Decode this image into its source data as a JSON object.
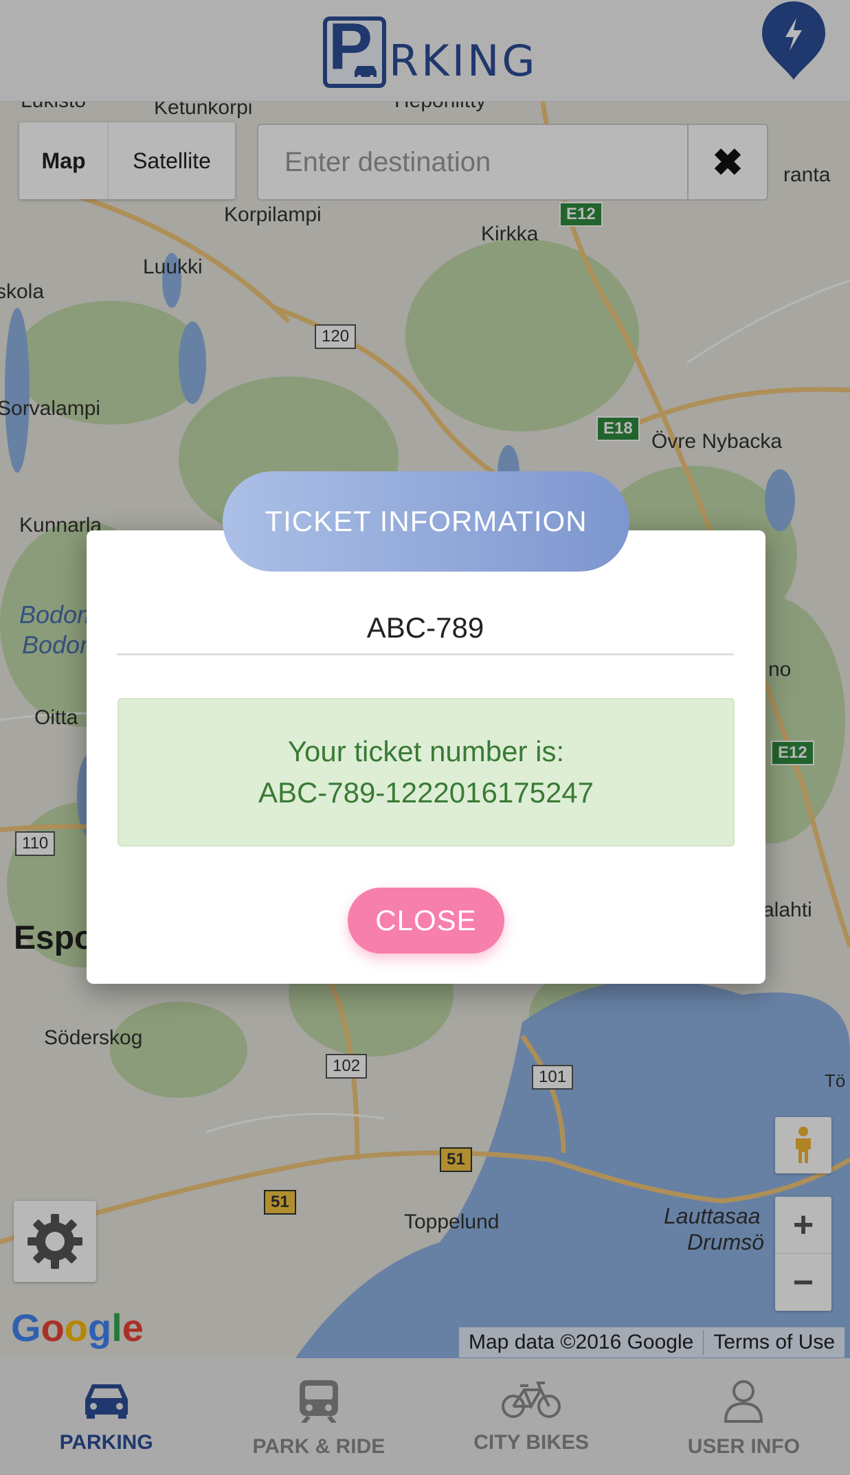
{
  "header": {
    "logo_text": "RKING",
    "logo_initial": "P"
  },
  "map": {
    "map_type": {
      "map_label": "Map",
      "satellite_label": "Satellite"
    },
    "destination": {
      "placeholder": "Enter destination",
      "value": ""
    },
    "clear_icon": "close-icon",
    "places": [
      "Ketunkorpi",
      "Korpilampi",
      "Kirkka",
      "Luukki",
      "skola",
      "Sorvalampi",
      "Övre Nybacka",
      "Kunnarla",
      "Bodom",
      "Bodom",
      "Oitta",
      "no",
      "Espo",
      "Söderskog",
      "Toppelund",
      "Lauttasaa",
      "Drumsö",
      "alahti",
      "ranta",
      "Lukisto",
      "Heponiitty",
      "Tö"
    ],
    "roads": [
      "E12",
      "120",
      "E18",
      "E12",
      "110",
      "102",
      "101",
      "51",
      "51"
    ],
    "google_logo": "Google",
    "attribution": {
      "data": "Map data ©2016 Google",
      "terms": "Terms of Use"
    },
    "zoom_in": "+",
    "zoom_out": "−"
  },
  "modal": {
    "title": "TICKET INFORMATION",
    "plate": "ABC-789",
    "message_line1": "Your ticket number is:",
    "message_line2": "ABC-789-1222016175247",
    "close_label": "CLOSE"
  },
  "nav": {
    "items": [
      {
        "label": "PARKING",
        "icon": "car-icon",
        "active": true
      },
      {
        "label": "PARK & RIDE",
        "icon": "train-icon",
        "active": false
      },
      {
        "label": "CITY BIKES",
        "icon": "bike-icon",
        "active": false
      },
      {
        "label": "USER INFO",
        "icon": "user-icon",
        "active": false
      }
    ]
  },
  "colors": {
    "brand": "#2c4e98",
    "close_button": "#f77fab",
    "alert_bg": "#ddeed5",
    "alert_text": "#3a7a35"
  }
}
